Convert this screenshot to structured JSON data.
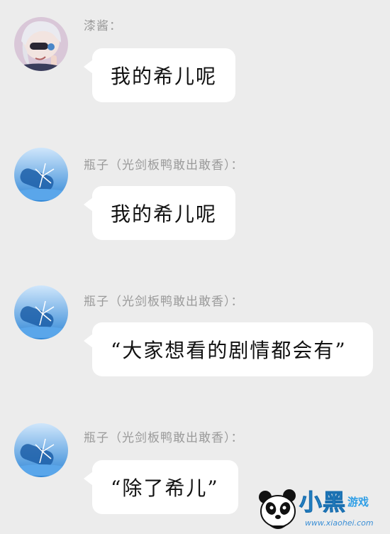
{
  "messages": [
    {
      "sender": "漆酱：",
      "text": "我的希儿呢",
      "avatar": "anime-girl-avatar"
    },
    {
      "sender": "瓶子（光剑板鸭敢出敢香）：",
      "text": "我的希儿呢",
      "avatar": "bottle-avatar"
    },
    {
      "sender": "瓶子（光剑板鸭敢出敢香）：",
      "text": "“大家想看的剧情都会有”",
      "avatar": "bottle-avatar"
    },
    {
      "sender": "瓶子（光剑板鸭敢出敢香）：",
      "text": "“除了希儿”",
      "avatar": "bottle-avatar"
    }
  ],
  "watermark": {
    "brand_big": "小黑",
    "brand_small": "游戏",
    "url": "www.xiaohei.com"
  }
}
